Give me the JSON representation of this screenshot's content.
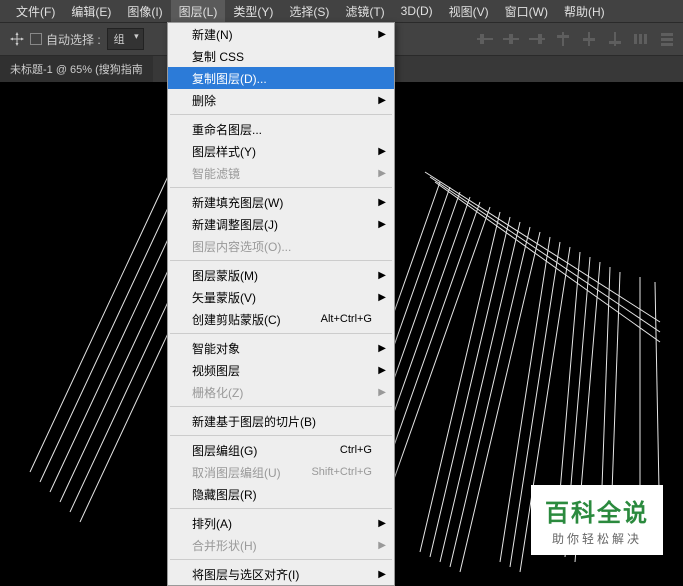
{
  "menubar": {
    "items": [
      {
        "label": "文件(F)"
      },
      {
        "label": "编辑(E)"
      },
      {
        "label": "图像(I)"
      },
      {
        "label": "图层(L)"
      },
      {
        "label": "类型(Y)"
      },
      {
        "label": "选择(S)"
      },
      {
        "label": "滤镜(T)"
      },
      {
        "label": "3D(D)"
      },
      {
        "label": "视图(V)"
      },
      {
        "label": "窗口(W)"
      },
      {
        "label": "帮助(H)"
      }
    ],
    "active_index": 3
  },
  "toolbar": {
    "auto_select_label": "自动选择 :",
    "dropdown_value": "组"
  },
  "tab": {
    "title": "未标题-1 @ 65% (搜狗指南"
  },
  "layer_menu": {
    "items": [
      {
        "label": "新建(N)",
        "submenu": true
      },
      {
        "label": "复制 CSS"
      },
      {
        "label": "复制图层(D)...",
        "highlighted": true
      },
      {
        "label": "删除",
        "submenu": true
      },
      {
        "sep": true
      },
      {
        "label": "重命名图层..."
      },
      {
        "label": "图层样式(Y)",
        "submenu": true
      },
      {
        "label": "智能滤镜",
        "submenu": true,
        "disabled": true
      },
      {
        "sep": true
      },
      {
        "label": "新建填充图层(W)",
        "submenu": true
      },
      {
        "label": "新建调整图层(J)",
        "submenu": true
      },
      {
        "label": "图层内容选项(O)...",
        "disabled": true
      },
      {
        "sep": true
      },
      {
        "label": "图层蒙版(M)",
        "submenu": true
      },
      {
        "label": "矢量蒙版(V)",
        "submenu": true
      },
      {
        "label": "创建剪贴蒙版(C)",
        "shortcut": "Alt+Ctrl+G"
      },
      {
        "sep": true
      },
      {
        "label": "智能对象",
        "submenu": true
      },
      {
        "label": "视频图层",
        "submenu": true
      },
      {
        "label": "栅格化(Z)",
        "submenu": true,
        "disabled": true
      },
      {
        "sep": true
      },
      {
        "label": "新建基于图层的切片(B)"
      },
      {
        "sep": true
      },
      {
        "label": "图层编组(G)",
        "shortcut": "Ctrl+G"
      },
      {
        "label": "取消图层编组(U)",
        "shortcut": "Shift+Ctrl+G",
        "disabled": true
      },
      {
        "label": "隐藏图层(R)"
      },
      {
        "sep": true
      },
      {
        "label": "排列(A)",
        "submenu": true
      },
      {
        "label": "合并形状(H)",
        "submenu": true,
        "disabled": true
      },
      {
        "sep": true
      },
      {
        "label": "将图层与选区对齐(I)",
        "submenu": true
      }
    ]
  },
  "watermark": {
    "title": "百科全说",
    "subtitle": "助你轻松解决"
  }
}
